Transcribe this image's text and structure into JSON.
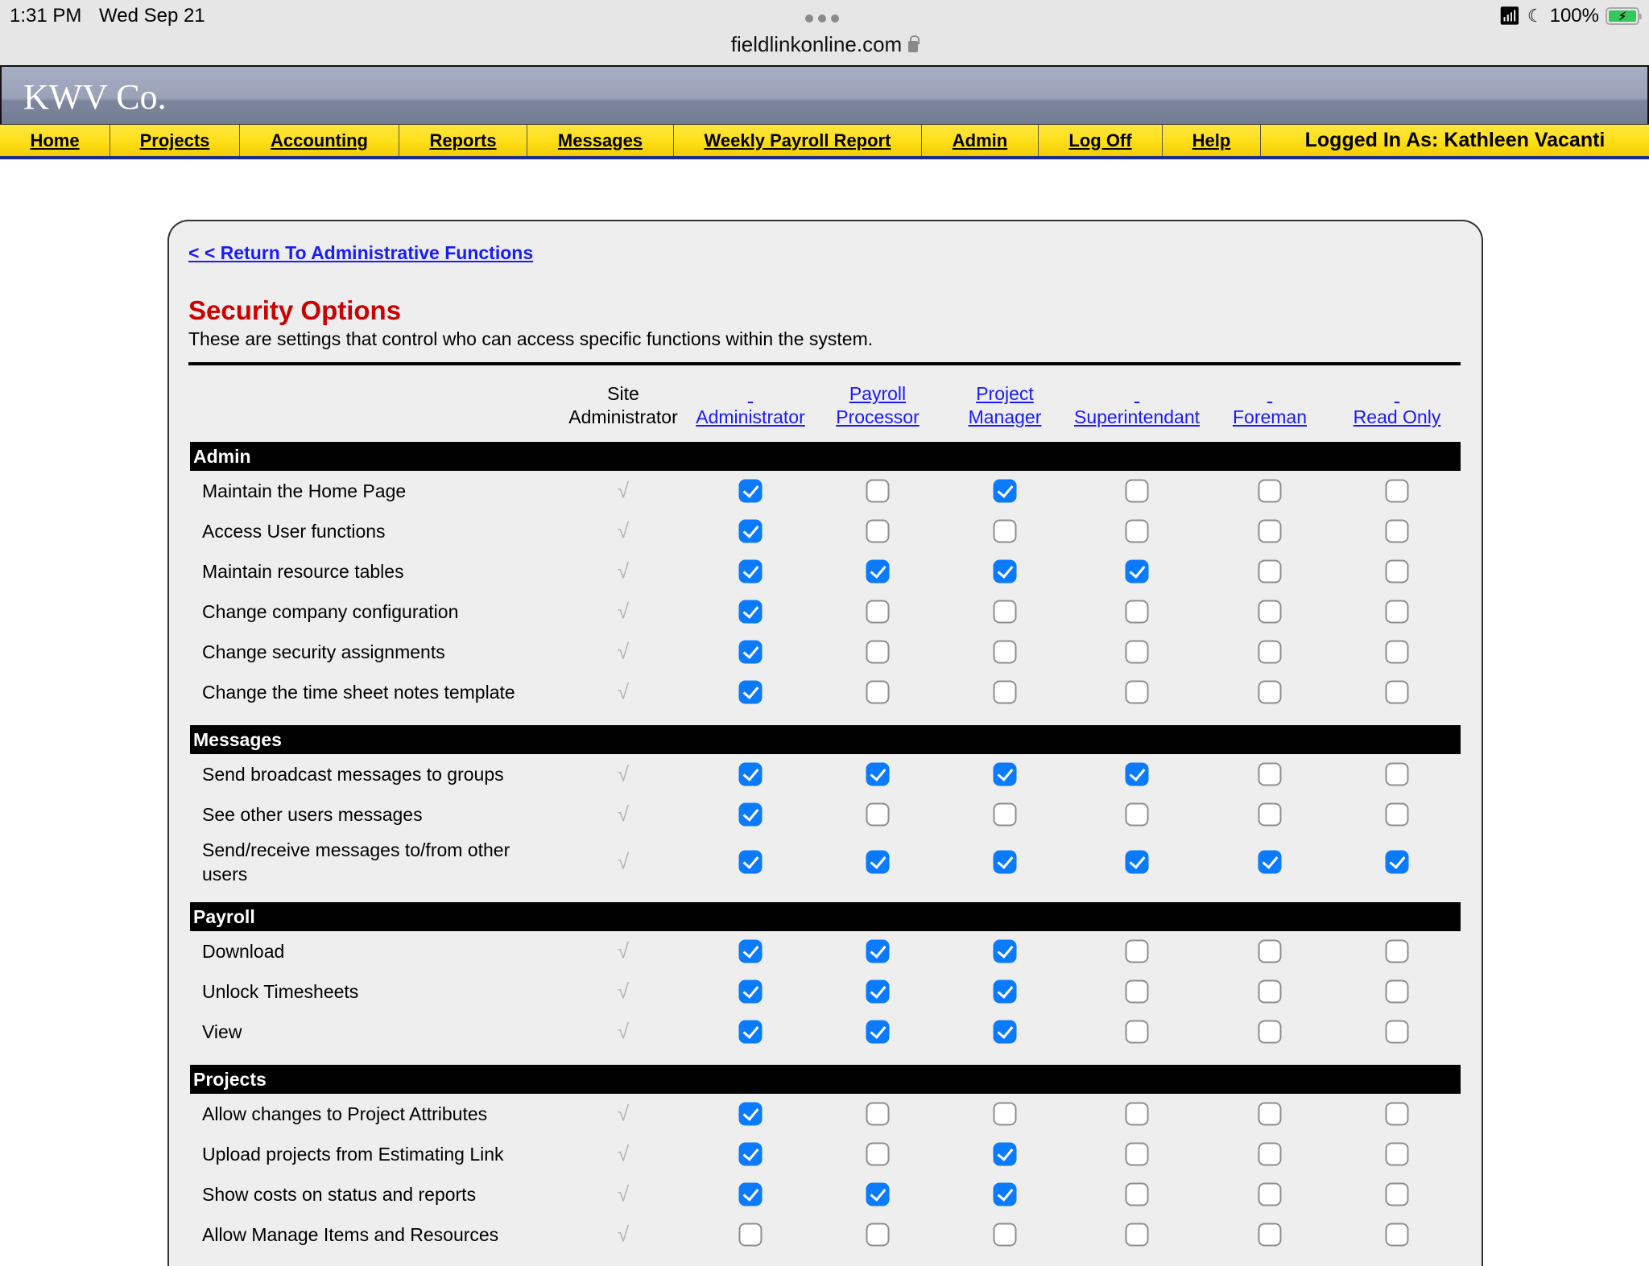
{
  "status_bar": {
    "time": "1:31 PM",
    "date": "Wed Sep 21",
    "url": "fieldlinkonline.com",
    "battery": "100%",
    "icons": [
      "wifi-icon",
      "moon-icon",
      "battery-charging-icon",
      "lock-icon"
    ]
  },
  "brand": {
    "name": "KWV Co."
  },
  "nav": {
    "items": [
      {
        "label": "Home"
      },
      {
        "label": "Projects"
      },
      {
        "label": "Accounting"
      },
      {
        "label": "Reports"
      },
      {
        "label": "Messages"
      },
      {
        "label": "Weekly Payroll Report"
      },
      {
        "label": "Admin"
      },
      {
        "label": "Log Off"
      },
      {
        "label": "Help"
      }
    ],
    "logged_in": "Logged In As: Kathleen Vacanti"
  },
  "page": {
    "return_link": "< < Return To Administrative Functions",
    "title": "Security Options",
    "subtitle": "These are settings that control who can access specific functions within the system."
  },
  "columns": [
    {
      "label_line1": "Site",
      "label_line2": "Administrator",
      "link": false
    },
    {
      "label_line1": "",
      "label_line2": "Administrator",
      "link": true
    },
    {
      "label_line1": "Payroll",
      "label_line2": "Processor",
      "link": true
    },
    {
      "label_line1": "Project",
      "label_line2": "Manager",
      "link": true
    },
    {
      "label_line1": "",
      "label_line2": "Superintendant",
      "link": true
    },
    {
      "label_line1": "",
      "label_line2": "Foreman",
      "link": true
    },
    {
      "label_line1": "",
      "label_line2": "Read Only",
      "link": true
    }
  ],
  "sections": [
    {
      "name": "Admin",
      "rows": [
        {
          "label": "Maintain the Home Page",
          "values": [
            true,
            true,
            false,
            true,
            false,
            false,
            false
          ]
        },
        {
          "label": "Access User functions",
          "values": [
            true,
            true,
            false,
            false,
            false,
            false,
            false
          ]
        },
        {
          "label": "Maintain resource tables",
          "values": [
            true,
            true,
            true,
            true,
            true,
            false,
            false
          ]
        },
        {
          "label": "Change company configuration",
          "values": [
            true,
            true,
            false,
            false,
            false,
            false,
            false
          ]
        },
        {
          "label": "Change security assignments",
          "values": [
            true,
            true,
            false,
            false,
            false,
            false,
            false
          ]
        },
        {
          "label": "Change the time sheet notes template",
          "values": [
            true,
            true,
            false,
            false,
            false,
            false,
            false
          ]
        }
      ]
    },
    {
      "name": "Messages",
      "rows": [
        {
          "label": "Send broadcast messages to groups",
          "values": [
            true,
            true,
            true,
            true,
            true,
            false,
            false
          ]
        },
        {
          "label": "See other users messages",
          "values": [
            true,
            true,
            false,
            false,
            false,
            false,
            false
          ]
        },
        {
          "label": "Send/receive messages to/from other users",
          "values": [
            true,
            true,
            true,
            true,
            true,
            true,
            true
          ]
        }
      ]
    },
    {
      "name": "Payroll",
      "rows": [
        {
          "label": "Download",
          "values": [
            true,
            true,
            true,
            true,
            false,
            false,
            false
          ]
        },
        {
          "label": "Unlock Timesheets",
          "values": [
            true,
            true,
            true,
            true,
            false,
            false,
            false
          ]
        },
        {
          "label": "View",
          "values": [
            true,
            true,
            true,
            true,
            false,
            false,
            false
          ]
        }
      ]
    },
    {
      "name": "Projects",
      "rows": [
        {
          "label": "Allow changes to Project Attributes",
          "values": [
            true,
            true,
            false,
            false,
            false,
            false,
            false
          ]
        },
        {
          "label": "Upload projects from Estimating Link",
          "values": [
            true,
            true,
            false,
            true,
            false,
            false,
            false
          ]
        },
        {
          "label": "Show costs on status and reports",
          "values": [
            true,
            true,
            true,
            true,
            false,
            false,
            false
          ]
        },
        {
          "label": "Allow Manage Items and Resources",
          "values": [
            true,
            false,
            false,
            false,
            false,
            false,
            false
          ]
        }
      ]
    }
  ],
  "colors": {
    "title_red": "#cc0000",
    "link_blue": "#1a1aff",
    "nav_yellow": "#ffe01a",
    "checkbox_blue": "#0a7aff"
  }
}
